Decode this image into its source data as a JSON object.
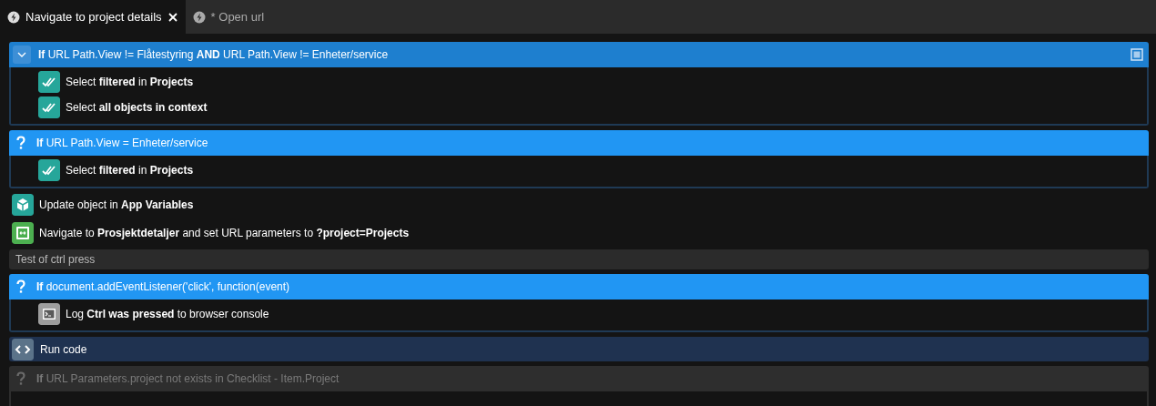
{
  "tabs": [
    {
      "label": "Navigate to project details",
      "selected": true
    },
    {
      "label": "* Open url",
      "selected": false
    }
  ],
  "blocks": [
    {
      "kind": "condition",
      "text": "**If** URL Path.View != Flåtestyring **AND** URL Path.View != Enheter/service",
      "selected": true,
      "disabled": false,
      "children": [
        {
          "kind": "select",
          "text": "Select **filtered** in **Projects**"
        },
        {
          "kind": "select",
          "text": "Select **all objects in context**"
        }
      ]
    },
    {
      "kind": "condition",
      "text": "**If** URL Path.View = Enheter/service",
      "selected": false,
      "disabled": false,
      "children": [
        {
          "kind": "select",
          "text": "Select **filtered** in **Projects**"
        }
      ]
    },
    {
      "kind": "update",
      "text": "Update object in **App Variables**"
    },
    {
      "kind": "navigate",
      "text": "Navigate to **Prosjektdetaljer** and set URL parameters to **?project=Projects**"
    },
    {
      "kind": "comment",
      "text": "Test of ctrl press"
    },
    {
      "kind": "condition",
      "text": "**If** document.addEventListener('click', function(event)",
      "selected": false,
      "disabled": false,
      "children": [
        {
          "kind": "log",
          "text": "Log **Ctrl was pressed** to browser console"
        }
      ]
    },
    {
      "kind": "code",
      "text": "Run code"
    },
    {
      "kind": "condition",
      "text": "**If** URL Parameters.project not exists in Checklist - Item.Project",
      "selected": false,
      "disabled": true
    }
  ]
}
